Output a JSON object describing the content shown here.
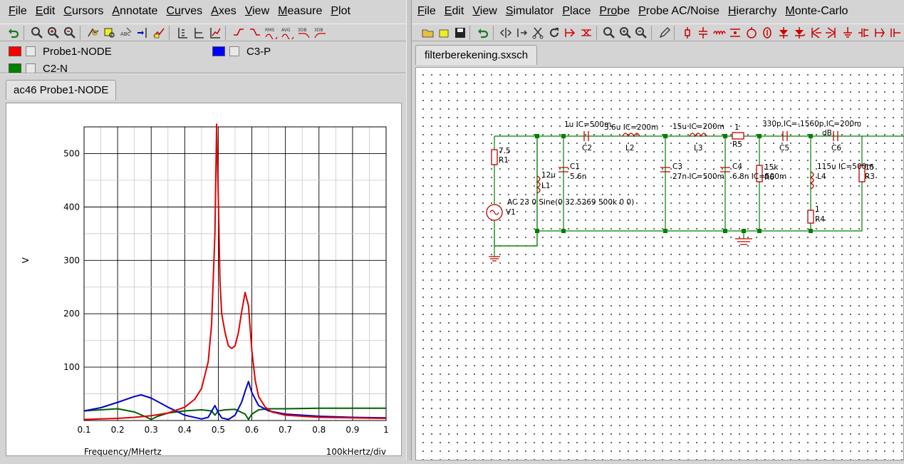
{
  "left_window": {
    "menu": [
      {
        "label": "File",
        "ul": "F",
        "rest": "ile"
      },
      {
        "label": "Edit",
        "ul": "E",
        "rest": "dit"
      },
      {
        "label": "Cursors",
        "ul": "C",
        "rest": "ursors"
      },
      {
        "label": "Annotate",
        "ul": "A",
        "rest": "nnotate"
      },
      {
        "label": "Curves",
        "ul": "Cu",
        "rest": "rves",
        "ul_index": 2
      },
      {
        "label": "Axes",
        "ul": "A",
        "rest": "xes"
      },
      {
        "label": "View",
        "ul": "V",
        "rest": "iew"
      },
      {
        "label": "Measure",
        "ul": "M",
        "rest": "easure"
      },
      {
        "label": "Plot",
        "ul": "P",
        "rest": "lot"
      }
    ],
    "toolbar_icons": [
      "undo-icon",
      "zoom-full-icon",
      "zoom-in-icon",
      "zoom-out-icon",
      "sep",
      "zoom-box-icon",
      "zoom-select-icon",
      "abc-annotate-icon",
      "cursor-add-icon",
      "edit-curve-icon",
      "sep",
      "align-axes-icon",
      "axis-split-icon",
      "axis-grid-icon",
      "sep",
      "rise-icon",
      "fall-icon",
      "rms-icon",
      "avg-icon",
      "3db-low-icon",
      "3db-high-icon"
    ],
    "toolbar_text": {
      "rms": "RMS",
      "avg": "AVG",
      "db3": "3DB",
      "db3b": "3DB"
    },
    "legend": [
      {
        "label": "Probe1-NODE",
        "color": "#ff0000"
      },
      {
        "label": "C3-P",
        "color": "#0000ff"
      },
      {
        "label": "C2-N",
        "color": "#008000"
      }
    ],
    "tab": "ac46 Probe1-NODE"
  },
  "chart_data": {
    "type": "line",
    "title": "",
    "xlabel": "Frequency/MHertz",
    "ylabel": "V",
    "x_division_label": "100kHertz/div",
    "xlim": [
      0.1,
      1.0
    ],
    "ylim": [
      0,
      550
    ],
    "x_ticks": [
      "0.1",
      "0.2",
      "0.3",
      "0.4",
      "0.5",
      "0.6",
      "0.7",
      "0.8",
      "0.9",
      "1"
    ],
    "y_ticks": [
      "100",
      "200",
      "300",
      "400",
      "500"
    ],
    "grid": true,
    "series": [
      {
        "name": "Probe1-NODE",
        "color": "#e00000",
        "x": [
          0.1,
          0.15,
          0.2,
          0.25,
          0.3,
          0.35,
          0.4,
          0.43,
          0.45,
          0.47,
          0.48,
          0.49,
          0.495,
          0.5,
          0.505,
          0.51,
          0.52,
          0.53,
          0.54,
          0.55,
          0.56,
          0.57,
          0.58,
          0.59,
          0.6,
          0.61,
          0.62,
          0.64,
          0.66,
          0.7,
          0.8,
          0.9,
          1.0
        ],
        "y": [
          2,
          3,
          4,
          6,
          9,
          14,
          25,
          40,
          60,
          110,
          180,
          350,
          555,
          420,
          260,
          200,
          165,
          140,
          135,
          140,
          165,
          205,
          240,
          215,
          130,
          75,
          45,
          25,
          16,
          10,
          6,
          5,
          4
        ]
      },
      {
        "name": "C3-P",
        "color": "#0000d0",
        "x": [
          0.1,
          0.15,
          0.2,
          0.25,
          0.27,
          0.3,
          0.35,
          0.4,
          0.45,
          0.47,
          0.49,
          0.5,
          0.51,
          0.53,
          0.55,
          0.57,
          0.58,
          0.59,
          0.6,
          0.62,
          0.65,
          0.7,
          0.8,
          0.9,
          1.0
        ],
        "y": [
          18,
          24,
          34,
          45,
          48,
          42,
          25,
          10,
          3,
          6,
          28,
          15,
          5,
          2,
          10,
          35,
          55,
          73,
          52,
          28,
          18,
          12,
          8,
          6,
          5
        ]
      },
      {
        "name": "C2-N",
        "color": "#006000",
        "x": [
          0.1,
          0.15,
          0.2,
          0.25,
          0.28,
          0.3,
          0.32,
          0.35,
          0.4,
          0.45,
          0.48,
          0.49,
          0.5,
          0.52,
          0.55,
          0.58,
          0.59,
          0.6,
          0.62,
          0.65,
          0.7,
          0.8,
          0.9,
          1.0
        ],
        "y": [
          18,
          20,
          22,
          16,
          8,
          2,
          8,
          14,
          18,
          20,
          18,
          10,
          18,
          20,
          21,
          12,
          2,
          12,
          20,
          22,
          22,
          23,
          23,
          23
        ]
      }
    ]
  },
  "right_window": {
    "menu": [
      {
        "label": "File",
        "ul": "F",
        "rest": "ile"
      },
      {
        "label": "Edit",
        "ul": "E",
        "rest": "dit"
      },
      {
        "label": "View",
        "ul": "V",
        "rest": "iew"
      },
      {
        "label": "Simulator",
        "ul": "S",
        "rest": "imulator"
      },
      {
        "label": "Place",
        "ul": "P",
        "rest": "lace"
      },
      {
        "label": "Probe",
        "ul": "Pro",
        "rest": "be"
      },
      {
        "label": "Probe AC/Noise",
        "ul": "P",
        "rest": "robe AC/Noise"
      },
      {
        "label": "Hierarchy",
        "ul": "H",
        "rest": "ierarchy"
      },
      {
        "label": "Monte-Carlo",
        "ul": "M",
        "rest": "onte-Carlo"
      }
    ],
    "tab": "filterberekening.sxsch"
  },
  "schematic": {
    "labels": {
      "c2_val": "1u IC=500m",
      "c2": "C2",
      "l2_val": "3.6u IC=200m",
      "l2": "L2",
      "l3_val": "15u IC=200m",
      "l3": "L3",
      "r5_val": "1",
      "r5": "R5",
      "c5_val": "330p IC=-1560p IC=200m",
      "c5": "C5",
      "c6_val": "dB",
      "c6": "C6",
      "r1_val": "7.5",
      "r1": "R1",
      "l1_val": "12u",
      "l1": "L1",
      "c1": "C1",
      "c1_val": "5.6n",
      "c3": "C3",
      "c3_val": "27n IC=500m",
      "c4": "C4",
      "c4_val": "6.8n IC=500m",
      "r6_val": "15k",
      "r6": "R6",
      "l4_val": "115u IC=500m",
      "l4": "L4",
      "r3_val": "15",
      "r3": "R3",
      "r4_val": "1",
      "r4": "R4",
      "v1_val": "AC 23 0 Sine(0 32.5269 500k 0 0)",
      "v1": "V1"
    }
  }
}
